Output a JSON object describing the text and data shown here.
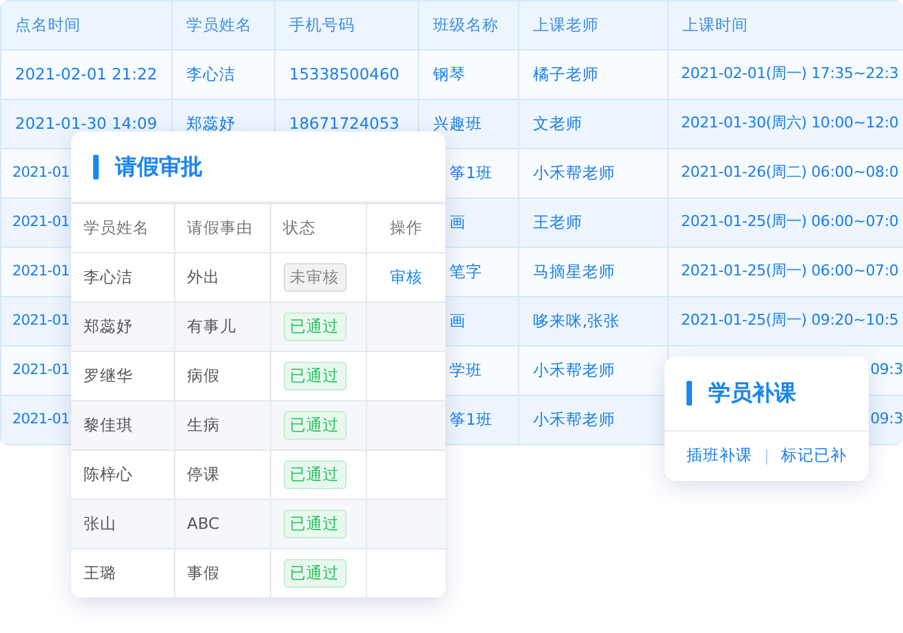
{
  "records_table": {
    "columns": [
      "点名时间",
      "学员姓名",
      "手机号码",
      "班级名称",
      "上课老师",
      "上课时间"
    ],
    "rows": [
      {
        "cells": [
          "2021-02-01 21:22",
          "李心洁",
          "15338500460",
          "钢琴",
          "橘子老师",
          "2021-02-01(周一) 17:35~22:3"
        ]
      },
      {
        "cells": [
          "2021-01-30 14:09",
          "郑蕊妤",
          "18671724053",
          "兴趣班",
          "文老师",
          "2021-01-30(周六) 10:00~12:0"
        ]
      },
      {
        "cells": [
          "2021-01",
          "",
          "",
          "筝1班",
          "小禾帮老师",
          "2021-01-26(周二) 06:00~08:0"
        ]
      },
      {
        "cells": [
          "2021-01",
          "",
          "",
          "画",
          "王老师",
          "2021-01-25(周一) 06:00~07:0"
        ]
      },
      {
        "cells": [
          "2021-01",
          "",
          "",
          "笔字",
          "马摘星老师",
          "2021-01-25(周一) 06:00~07:0"
        ]
      },
      {
        "cells": [
          "2021-01",
          "",
          "",
          "画",
          "哆来咪,张张",
          "2021-01-25(周一) 09:20~10:5"
        ]
      },
      {
        "cells": [
          "2021-01",
          "",
          "",
          "学班",
          "小禾帮老师",
          "09:3"
        ]
      },
      {
        "cells": [
          "2021-01",
          "",
          "",
          "筝1班",
          "小禾帮老师",
          "09:3"
        ]
      }
    ]
  },
  "leave_approval": {
    "title": "请假审批",
    "columns": [
      "学员姓名",
      "请假事由",
      "状态",
      "操作"
    ],
    "rows": [
      {
        "student": "李心洁",
        "reason": "外出",
        "status": {
          "text": "未审核",
          "kind": "pending"
        },
        "action": "审核"
      },
      {
        "student": "郑蕊妤",
        "reason": "有事儿",
        "status": {
          "text": "已通过",
          "kind": "approved"
        }
      },
      {
        "student": "罗继华",
        "reason": "病假",
        "status": {
          "text": "已通过",
          "kind": "approved"
        }
      },
      {
        "student": "黎佳琪",
        "reason": "生病",
        "status": {
          "text": "已通过",
          "kind": "approved"
        }
      },
      {
        "student": "陈梓心",
        "reason": "停课",
        "status": {
          "text": "已通过",
          "kind": "approved"
        }
      },
      {
        "student": "张山",
        "reason": "ABC",
        "status": {
          "text": "已通过",
          "kind": "approved"
        }
      },
      {
        "student": "王璐",
        "reason": "事假",
        "status": {
          "text": "已通过",
          "kind": "approved"
        }
      }
    ]
  },
  "makeup": {
    "title": "学员补课",
    "actions": [
      "插班补课",
      "标记已补"
    ]
  }
}
